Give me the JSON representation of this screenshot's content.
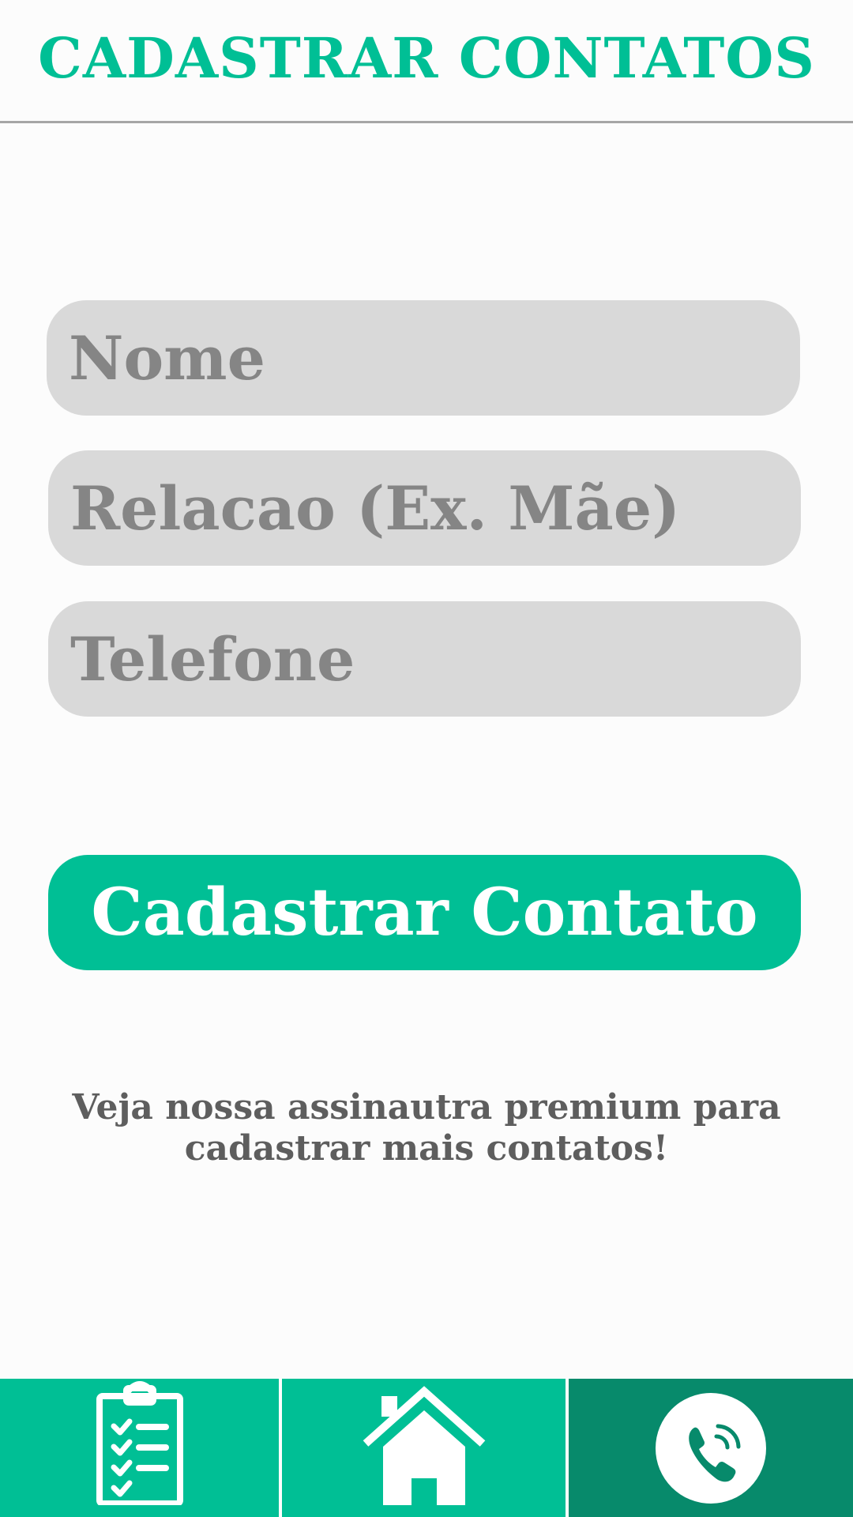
{
  "header": {
    "title": "CADASTRAR CONTATOS"
  },
  "form": {
    "name_placeholder": "Nome",
    "relation_placeholder": "Relacao (Ex. Mãe)",
    "phone_placeholder": "Telefone",
    "submit_label": "Cadastrar Contato"
  },
  "promo": {
    "line1": "Veja nossa assinautra premium para",
    "line2": "cadastrar mais contatos!"
  },
  "navbar": {
    "items": [
      {
        "icon": "clipboard-checklist-icon",
        "active": false
      },
      {
        "icon": "home-icon",
        "active": false
      },
      {
        "icon": "phone-call-icon",
        "active": true
      }
    ]
  },
  "colors": {
    "accent": "#00bf95",
    "accent_dark": "#078a6b",
    "field_bg": "#d9d9d9",
    "placeholder": "#858585",
    "promo_text": "#5e5e5e",
    "background": "#fcfcfc"
  }
}
